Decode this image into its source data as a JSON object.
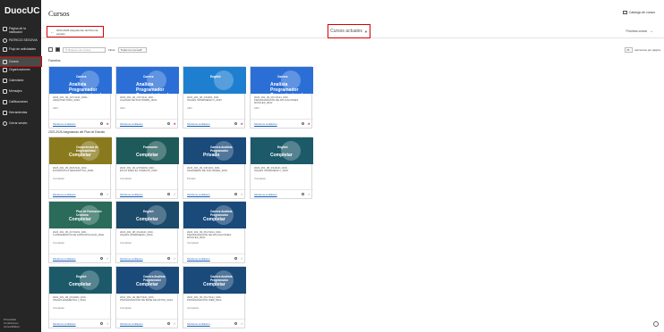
{
  "sidebar": {
    "logo": "DuocUC",
    "items": [
      {
        "label": "Página de la institución",
        "icon": "institution-icon"
      },
      {
        "label": "PATRICIO SEGOVIA",
        "icon": "user-icon"
      },
      {
        "label": "Flujo de actividades",
        "icon": "activity-stream-icon"
      },
      {
        "label": "Cursos",
        "icon": "courses-icon",
        "active": true
      },
      {
        "label": "Organizaciones",
        "icon": "organizations-icon"
      },
      {
        "label": "Calendario",
        "icon": "calendar-icon"
      },
      {
        "label": "Mensajes",
        "icon": "messages-icon"
      },
      {
        "label": "Calificaciones",
        "icon": "grades-icon"
      },
      {
        "label": "Herramientas",
        "icon": "tools-icon"
      },
      {
        "label": "Cerrar sesión",
        "icon": "logout-icon"
      }
    ],
    "footer": [
      "Privacidad",
      "Condiciones",
      "Accesibilidad"
    ]
  },
  "header": {
    "title": "Cursos",
    "catalog_label": "Catálogo de cursos"
  },
  "topbar": {
    "prev_label": "2023-2026 Asignaturas del Plan de estudio",
    "term_label": "Cursos actuales",
    "next_label": "Próximos cursos"
  },
  "filters": {
    "search_placeholder": "Busque sus cursos",
    "filter_label": "Filtrar",
    "filter_value": "Todos los cursos",
    "perpage_value": "25",
    "perpage_label": "elementos por página"
  },
  "sections": {
    "favorites": "Favoritos",
    "plan": "2023-2026 Asignaturas del Plan de Estudio",
    "y2023": "2023-2023",
    "y2022": "2022-2022",
    "y2018": "2022-2018"
  },
  "cards": [
    {
      "code": "2023_001_09_ASY4131_D001...",
      "name": "ARQUITECTURA_003A",
      "status": "Abrir",
      "banner_line1": "Carrera",
      "banner_line2": "Analista Programador Computacional",
      "color": "#2b6fd6",
      "favorite": true,
      "tutor": "Síndrome confiasmo"
    },
    {
      "code": "2023_001_09_CSY4111_D00...",
      "name": "CALIDAD DE SOFTWARE_003V",
      "status": "Abrir",
      "banner_line1": "Carrera",
      "banner_line2": "Analista Programador Computacional",
      "color": "#2b6fd6",
      "favorite": true,
      "tutor": "Síndrome confiasmo"
    },
    {
      "code": "2023_001_08_INI4001_D00...",
      "name": "INGLÉS INTERMEDIO II_003V",
      "status": "Abrir",
      "banner_line1": "English",
      "banner_line2": "",
      "color": "#1e7fd0",
      "favorite": true,
      "tutor": "Síndrome confiasmo"
    },
    {
      "code": "2023_001_09_PGY4121_D00...",
      "name": "PROGRAMACIÓN DE APLICACIONES MÓVILES_003V",
      "status": "Abrir",
      "banner_line1": "Carrera",
      "banner_line2": "Analista Programador Computacional",
      "color": "#2b6fd6",
      "favorite": true,
      "tutor": "Síndrome confiasmo"
    },
    {
      "code": "2023_001_05_MAT4141_D00...",
      "name": "ESTADÍSTICA DESCRIPTIVA_003D",
      "status": "Completar",
      "banner_line1": "Competencia de Empleabilidad",
      "banner_line2": "Completar",
      "color": "#8a7a1e",
      "favorite": false,
      "tutor": "Síndrome confiasmo"
    },
    {
      "code": "2023_001_09_ETW4001_D00...",
      "name": "ÉTICA PARA EL TRABAJO_003V",
      "status": "Completar",
      "banner_line1": "Formación",
      "banner_line2": "Completar",
      "color": "#1f5a5a",
      "favorite": false,
      "tutor": "Síndrome confiasmo"
    },
    {
      "code": "2023_001_09_INF4101_D00...",
      "name": "INGENIERÍA DE SOFTWARE_003V",
      "status": "Privado",
      "banner_line1": "Carrera Analista Programador",
      "banner_line2": "Privado",
      "color": "#1a4a7a",
      "favorite": false,
      "tutor": "Síndrome confiasmo"
    },
    {
      "code": "2023_001_08_INU2101_D00...",
      "name": "INGLÉS INTERMEDIO I_003V",
      "status": "Completar",
      "banner_line1": "English",
      "banner_line2": "Completar",
      "color": "#1c5a6a",
      "favorite": false,
      "tutor": "Síndrome confiasmo"
    },
    {
      "code": "2023_001_05_FCT1001_D00...",
      "name": "FUNDAMENTOS DE ANTROPOLOGÍA_003A",
      "status": "Completar",
      "banner_line1": "Plan de Formación Cristiana",
      "banner_line2": "Completar",
      "color": "#2a6b5a",
      "favorite": false,
      "tutor": "Síndrome confiasmo"
    },
    {
      "code": "2023_001_08_INU4101_D00...",
      "name": "INGLÉS INTERMEDIO_003A",
      "status": "Completar",
      "banner_line1": "English",
      "banner_line2": "Completar",
      "color": "#1c4a6a",
      "favorite": false,
      "tutor": "Síndrome confiasmo"
    },
    {
      "code": "2023_001_09_PGY4101_D00...",
      "name": "PROGRAMACIÓN DE APLICACIONES MÓVILES_003V",
      "status": "Completar",
      "banner_line1": "Carrera Analista Programador",
      "banner_line2": "Completar",
      "color": "#1a4a7a",
      "favorite": false,
      "tutor": "Síndrome confiasmo"
    },
    {
      "code": "2022_001_08_INU2001_D00...",
      "name": "INGLÉS ELEMENTAL I_001A",
      "status": "Completar",
      "banner_line1": "English",
      "banner_line2": "Completar",
      "color": "#1c5a6a",
      "favorite": false,
      "tutor": "Síndrome confiasmo"
    },
    {
      "code": "2022_001_09_BDY3101_D00...",
      "name": "PROGRAMACIÓN DE BASE DE DATOS_001A",
      "status": "Completar",
      "banner_line1": "Carrera Analista Programador",
      "banner_line2": "Completar",
      "color": "#1a4a7a",
      "favorite": false,
      "tutor": "Síndrome confiasmo"
    },
    {
      "code": "2022_001_09_PGY3121_D00...",
      "name": "PROGRAMACIÓN WEB_001A",
      "status": "Completar",
      "banner_line1": "Carrera Analista Programador",
      "banner_line2": "Completar",
      "color": "#1a4a7a",
      "favorite": false,
      "tutor": "Síndrome confiasmo"
    }
  ]
}
